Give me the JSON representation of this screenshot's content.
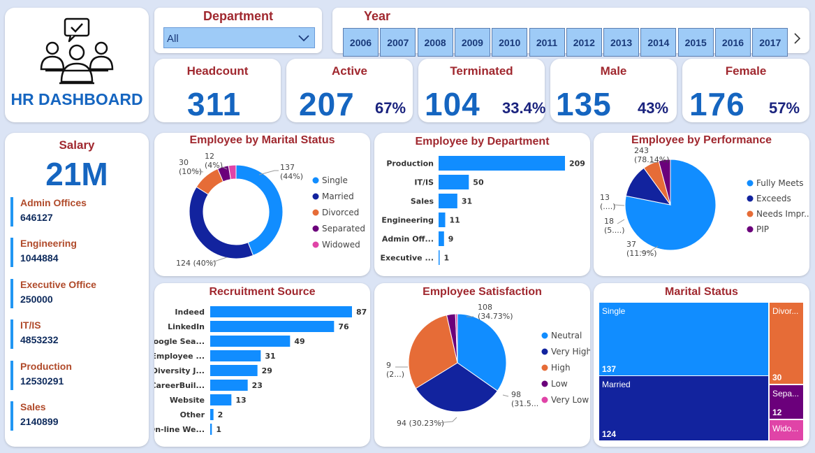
{
  "logo": {
    "title": "HR DASHBOARD"
  },
  "department_filter": {
    "title": "Department",
    "selected": "All"
  },
  "year_filter": {
    "title": "Year",
    "years": [
      "2006",
      "2007",
      "2008",
      "2009",
      "2010",
      "2011",
      "2012",
      "2013",
      "2014",
      "2015",
      "2016",
      "2017"
    ]
  },
  "kpis": {
    "headcount": {
      "title": "Headcount",
      "value": "311"
    },
    "active": {
      "title": "Active",
      "value": "207",
      "pct": "67%"
    },
    "terminated": {
      "title": "Terminated",
      "value": "104",
      "pct": "33.4%"
    },
    "male": {
      "title": "Male",
      "value": "135",
      "pct": "43%"
    },
    "female": {
      "title": "Female",
      "value": "176",
      "pct": "57%"
    }
  },
  "salary": {
    "title": "Salary",
    "total": "21M",
    "items": [
      {
        "label": "Admin Offices",
        "value": "646127"
      },
      {
        "label": "Engineering",
        "value": "1044884"
      },
      {
        "label": "Executive Office",
        "value": "250000"
      },
      {
        "label": "IT/IS",
        "value": "4853232"
      },
      {
        "label": "Production",
        "value": "12530291"
      },
      {
        "label": "Sales",
        "value": "2140899"
      }
    ]
  },
  "colors": {
    "blue": "#118dff",
    "navy": "#12239e",
    "orange": "#e66c37",
    "purple": "#6b007b",
    "pink": "#e044a7",
    "bar": "#118dff",
    "title": "#a0282f"
  },
  "chart_data": [
    {
      "id": "marital_status_donut",
      "type": "pie",
      "title": "Employee by Marital Status",
      "categories": [
        "Single",
        "Married",
        "Divorced",
        "Separated",
        "Widowed"
      ],
      "values": [
        137,
        124,
        30,
        12,
        8
      ],
      "labels": [
        "137\n(44%)",
        "124 (40%)",
        "30\n(10%)",
        "12\n(4%)",
        ""
      ],
      "legend": "right"
    },
    {
      "id": "department_bar",
      "type": "bar",
      "title": "Employee by Department",
      "categories": [
        "Production",
        "IT/IS",
        "Sales",
        "Engineering",
        "Admin Off...",
        "Executive ..."
      ],
      "values": [
        209,
        50,
        31,
        11,
        9,
        1
      ],
      "orientation": "horizontal"
    },
    {
      "id": "performance_pie",
      "type": "pie",
      "title": "Employee by Performance",
      "categories": [
        "Fully Meets",
        "Exceeds",
        "Needs Impr...",
        "PIP"
      ],
      "values": [
        243,
        37,
        18,
        13
      ],
      "labels": [
        "243\n(78.14%)",
        "37\n(11.9%)",
        "18\n(5....)",
        "13\n(....)"
      ],
      "legend": "right"
    },
    {
      "id": "recruitment_bar",
      "type": "bar",
      "title": "Recruitment Source",
      "categories": [
        "Indeed",
        "LinkedIn",
        "Google Sea...",
        "Employee ...",
        "Diversity J...",
        "CareerBuil...",
        "Website",
        "Other",
        "On-line We..."
      ],
      "values": [
        87,
        76,
        49,
        31,
        29,
        23,
        13,
        2,
        1
      ],
      "orientation": "horizontal"
    },
    {
      "id": "satisfaction_pie",
      "type": "pie",
      "title": "Employee Satisfaction",
      "categories": [
        "Neutral",
        "Very High",
        "High",
        "Low",
        "Very Low"
      ],
      "values": [
        108,
        98,
        94,
        9,
        2
      ],
      "labels": [
        "108\n(34.73%)",
        "98\n(31.5...",
        "94 (30.23%)",
        "9\n(2...)",
        ""
      ],
      "legend": "right"
    },
    {
      "id": "marital_treemap",
      "type": "treemap",
      "title": "Marital Status",
      "categories": [
        "Single",
        "Married",
        "Divor...",
        "Sepa...",
        "Wido..."
      ],
      "values": [
        137,
        124,
        30,
        12,
        8
      ],
      "value_labels": [
        "137",
        "124",
        "30",
        "12",
        ""
      ]
    }
  ]
}
